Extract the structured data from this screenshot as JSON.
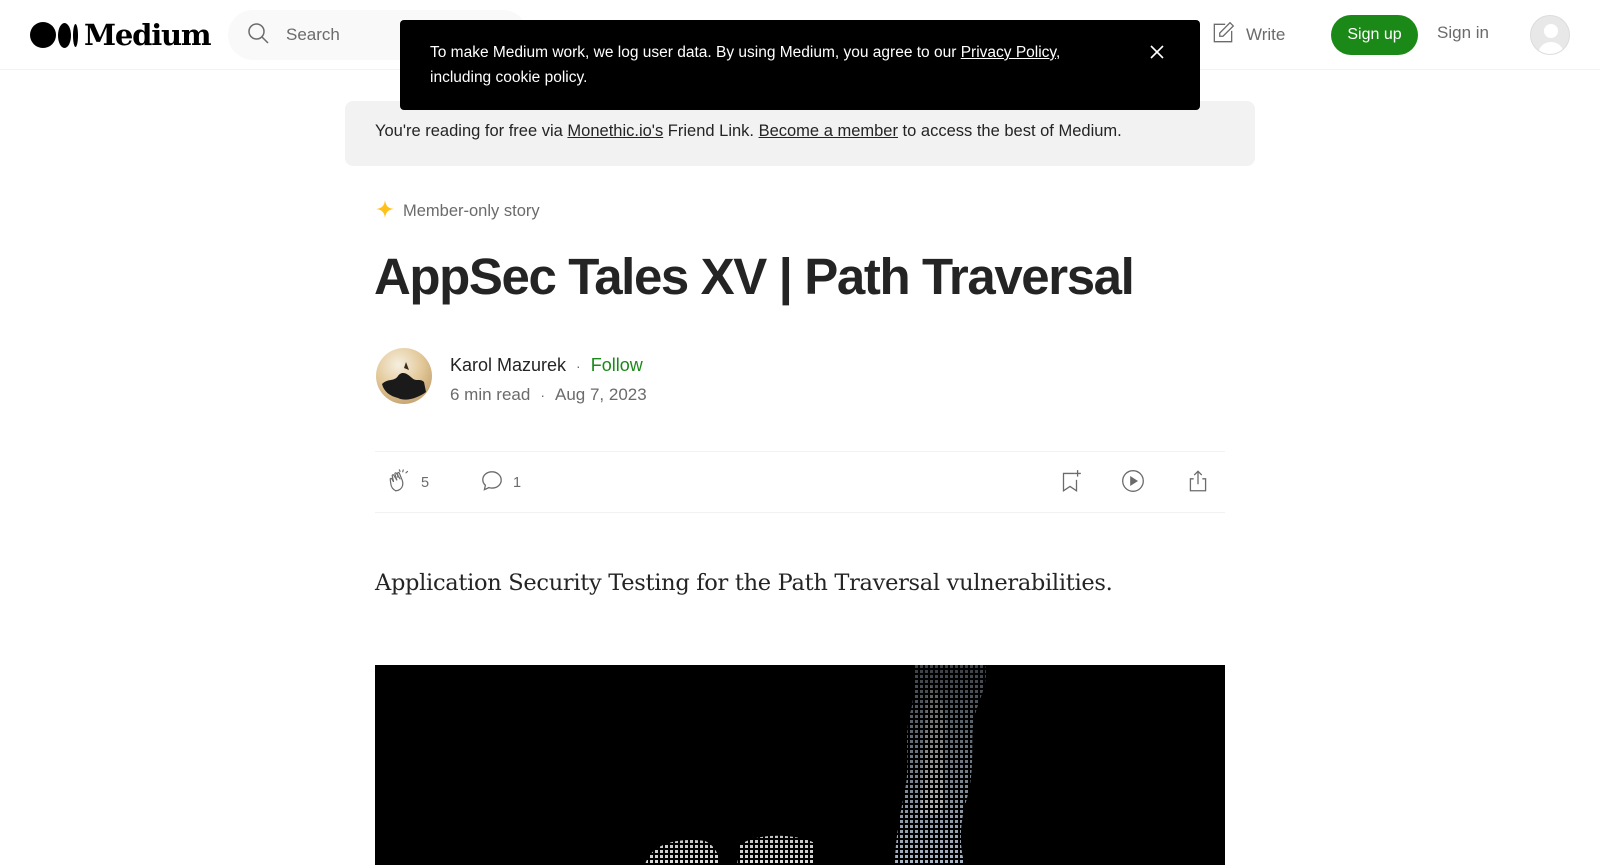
{
  "nav": {
    "logo_text": "Medium",
    "search_placeholder": "Search",
    "write_label": "Write",
    "signup_label": "Sign up",
    "signin_label": "Sign in"
  },
  "cookie_banner": {
    "text_before": "To make Medium work, we log user data. By using Medium, you agree to our ",
    "link_label": "Privacy Policy",
    "text_after": ", including cookie policy."
  },
  "friend_bar": {
    "text_1": "You're reading for free via ",
    "link_1": "Monethic.io's",
    "text_2": " Friend Link. ",
    "link_2": "Become a member",
    "text_3": " to access the best of Medium."
  },
  "article": {
    "badge": "Member-only story",
    "title": "AppSec Tales XV | Path Traversal",
    "author": "Karol Mazurek",
    "separator": "·",
    "follow_label": "Follow",
    "read_time": "6 min read",
    "date": "Aug 7, 2023",
    "subtitle": "Application Security Testing for the Path Traversal vulnerabilities."
  },
  "actions": {
    "claps": "5",
    "responses": "1"
  },
  "colors": {
    "accent_green": "#1a8917",
    "star_yellow": "#ffc017",
    "banner_bg": "#000000",
    "friend_bg": "#f2f2f2"
  },
  "icons": [
    "search-icon",
    "write-icon",
    "close-icon",
    "star-icon",
    "clap-icon",
    "comment-icon",
    "bookmark-icon",
    "play-icon",
    "share-icon"
  ]
}
